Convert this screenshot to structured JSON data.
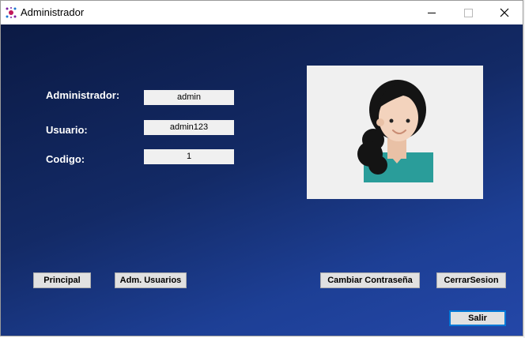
{
  "window": {
    "title": "Administrador"
  },
  "form": {
    "admin_label": "Administrador:",
    "admin_value": "admin",
    "user_label": "Usuario:",
    "user_value": "admin123",
    "code_label": "Codigo:",
    "code_value": "1"
  },
  "buttons": {
    "principal": "Principal",
    "adm_usuarios": "Adm. Usuarios",
    "cambiar": "Cambiar Contraseña",
    "cerrar": "CerrarSesion",
    "salir": "Salir"
  },
  "colors": {
    "background_top": "#0b1a44",
    "background_bottom": "#2447a8",
    "accent": "#0078d7",
    "shirt": "#2a9d9a"
  },
  "icons": [
    "app-icon",
    "minimize-icon",
    "maximize-icon",
    "close-icon",
    "avatar"
  ]
}
